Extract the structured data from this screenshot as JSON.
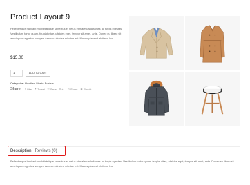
{
  "product": {
    "title": "Product Layout 9",
    "short_description": "Pellentesque habitant morbi tristique senectus et netus et malesuada fames ac turpis egestas. Vestibulum tortor quam, feugiat vitae, ultricies eget, tempor sit amet, ante. Donec eu libero sit amet quam egestas semper. Aenean ultricies mi vitae est. Mauris placerat eleifend leo.",
    "price": "$15.00",
    "quantity": "1",
    "add_to_cart_label": "ADD TO CART",
    "categories_label": "Categories:",
    "categories_value": "Hoodies, Music, Posters"
  },
  "share": {
    "label": "Share:",
    "items": [
      {
        "label": "Like",
        "icon": "facebook-icon"
      },
      {
        "label": "Tweet",
        "icon": "twitter-icon"
      },
      {
        "label": "Save",
        "icon": "pinterest-icon"
      },
      {
        "label": "+1",
        "icon": "google-plus-icon"
      },
      {
        "label": "Share",
        "icon": "linkedin-icon"
      },
      {
        "label": "Reddit",
        "icon": "reddit-icon"
      }
    ]
  },
  "gallery": {
    "images": [
      {
        "name": "beige-blazer-image"
      },
      {
        "name": "camel-trench-coat-image"
      },
      {
        "name": "grey-parka-image"
      },
      {
        "name": "wooden-stool-image"
      }
    ]
  },
  "tabs": {
    "items": [
      {
        "label": "Description"
      },
      {
        "label": "Reviews (0)"
      }
    ],
    "active_index": 0,
    "highlight_color": "#e01818",
    "description_text": "Pellentesque habitant morbi tristique senectus et netus et malesuada fames ac turpis egestas. Vestibulum tortor quam, feugiat vitae, ultricies eget, tempor sit amet, ante. Donec eu libero sit amet quam egestas semper. Aenean ultricies mi vitae est. Mauris placerat eleifend leo."
  }
}
